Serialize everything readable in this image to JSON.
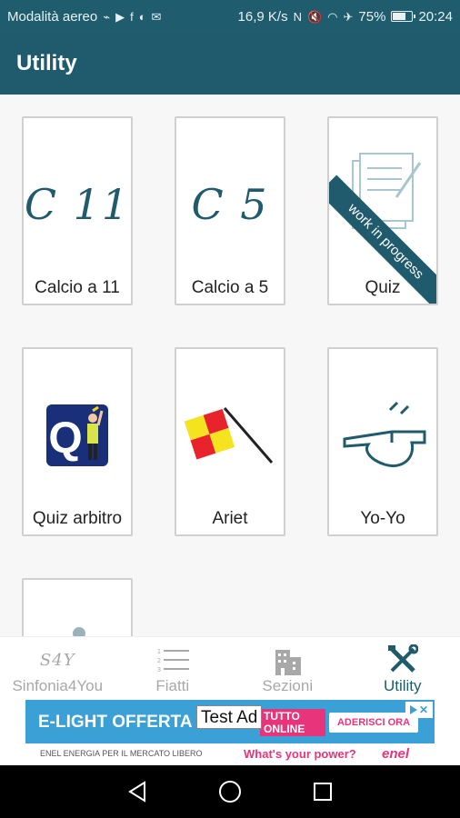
{
  "status_bar": {
    "left_text": "Modalità aereo",
    "speed": "16,9 K/s",
    "battery": "75%",
    "battery_level": 0.75,
    "time": "20:24",
    "icons": [
      "usb-icon",
      "play-store-icon",
      "facebook-icon",
      "shazam-icon",
      "mail-icon",
      "nfc-icon",
      "mute-icon",
      "wifi-icon",
      "airplane-icon",
      "battery-icon"
    ]
  },
  "app_bar": {
    "title": "Utility"
  },
  "tiles": [
    {
      "label": "Calcio a 11",
      "icon_text": "C 11",
      "icon": "c11-logo"
    },
    {
      "label": "Calcio a 5",
      "icon_text": "C 5",
      "icon": "c5-logo"
    },
    {
      "label": "Quiz",
      "icon": "document-icon",
      "ribbon": "work in progress"
    },
    {
      "label": "Quiz arbitro",
      "icon": "quiz-referee-icon",
      "icon_text": "Q"
    },
    {
      "label": "Ariet",
      "icon": "checkered-flag-icon"
    },
    {
      "label": "Yo-Yo",
      "icon": "whistle-icon"
    },
    {
      "label": "",
      "icon": "partial-tile"
    }
  ],
  "bottom_nav": {
    "items": [
      {
        "label": "Sinfonia4You",
        "icon": "s4y-logo",
        "icon_text": "S4Y",
        "active": false
      },
      {
        "label": "Fiatti",
        "icon": "numbered-list-icon",
        "active": false
      },
      {
        "label": "Sezioni",
        "icon": "building-icon",
        "active": false
      },
      {
        "label": "Utility",
        "icon": "tools-icon",
        "active": true
      }
    ]
  },
  "ad": {
    "headline": "E-LIGHT OFFERTA LUCE",
    "test_label": "Test Ad",
    "cta1": "TUTTO ONLINE",
    "cta2": "ADERISCI ORA",
    "bottom_left": "ENEL ENERGIA PER IL MERCATO LIBERO",
    "bottom_right": "What's your power?",
    "logo": "enel",
    "colors": {
      "blue": "#3aa0d6",
      "pink": "#e8347a"
    }
  },
  "colors": {
    "primary": "#1f5b6d",
    "background": "#f7f7f7",
    "inactive_nav": "#a8a8a8"
  }
}
